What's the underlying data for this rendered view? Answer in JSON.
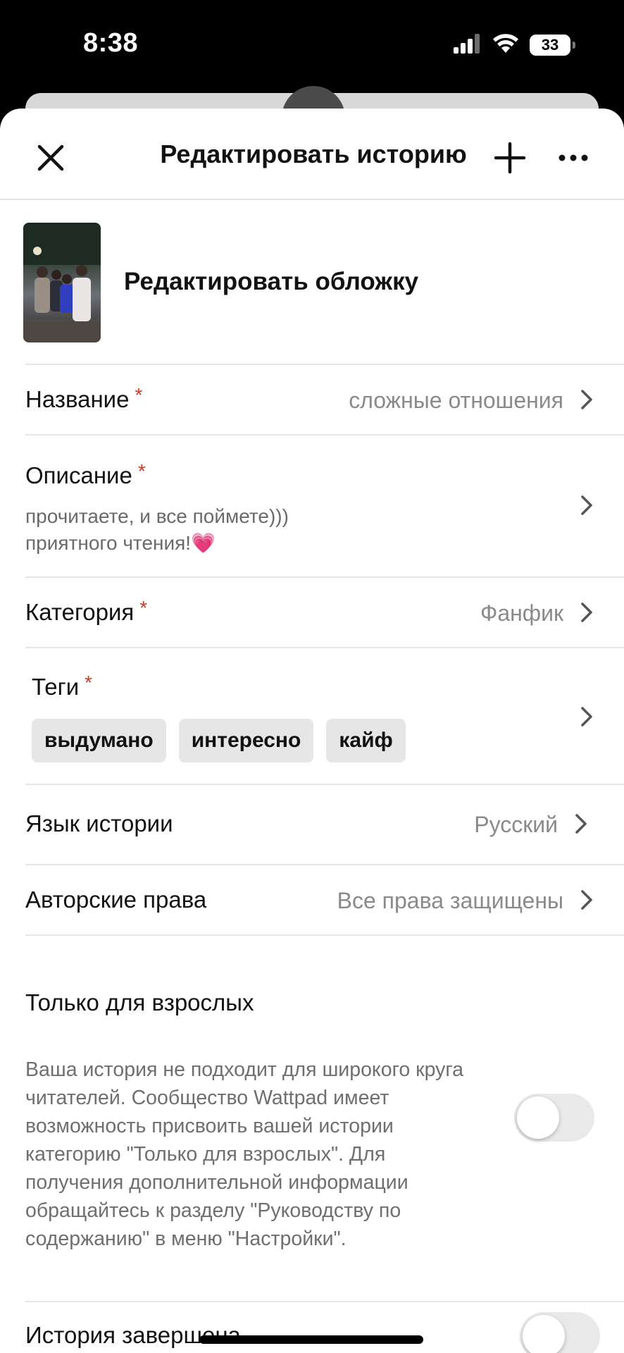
{
  "status_bar": {
    "time": "8:38",
    "battery_percent": "33",
    "battery_level": 0.33,
    "icons": [
      "signal-icon",
      "wifi-icon",
      "battery-icon"
    ]
  },
  "header": {
    "title": "Редактировать историю",
    "close_icon": "close-icon",
    "add_icon": "plus-icon",
    "more_icon": "more-horizontal-icon"
  },
  "cover": {
    "label": "Редактировать обложку"
  },
  "required_mark": "*",
  "fields": {
    "title": {
      "label": "Название",
      "value": "сложные отношения"
    },
    "description": {
      "label": "Описание",
      "line1": "прочитаете, и все поймете)))",
      "line2": "приятного чтения!💗"
    },
    "category": {
      "label": "Категория",
      "value": "Фанфик"
    },
    "tags": {
      "label": "Теги",
      "items": [
        "выдумано",
        "интересно",
        "кайф"
      ]
    },
    "language": {
      "label": "Язык истории",
      "value": "Русский"
    },
    "copyright": {
      "label": "Авторские права",
      "value": "Все права защищены"
    }
  },
  "mature": {
    "title": "Только для взрослых",
    "description": "Ваша история не подходит для широкого круга читателей. Сообщество Wattpad имеет возможность присвоить вашей истории категорию \"Только для взрослых\". Для получения дополнительной информации обращайтесь к разделу \"Руководству по содержанию\" в меню \"Настройки\".",
    "enabled": false
  },
  "completed": {
    "title": "История завершена",
    "enabled": false
  },
  "colors": {
    "required": "#d3371e",
    "toggle_off": "#e9e9ea",
    "muted_text": "#8a8a8a"
  }
}
